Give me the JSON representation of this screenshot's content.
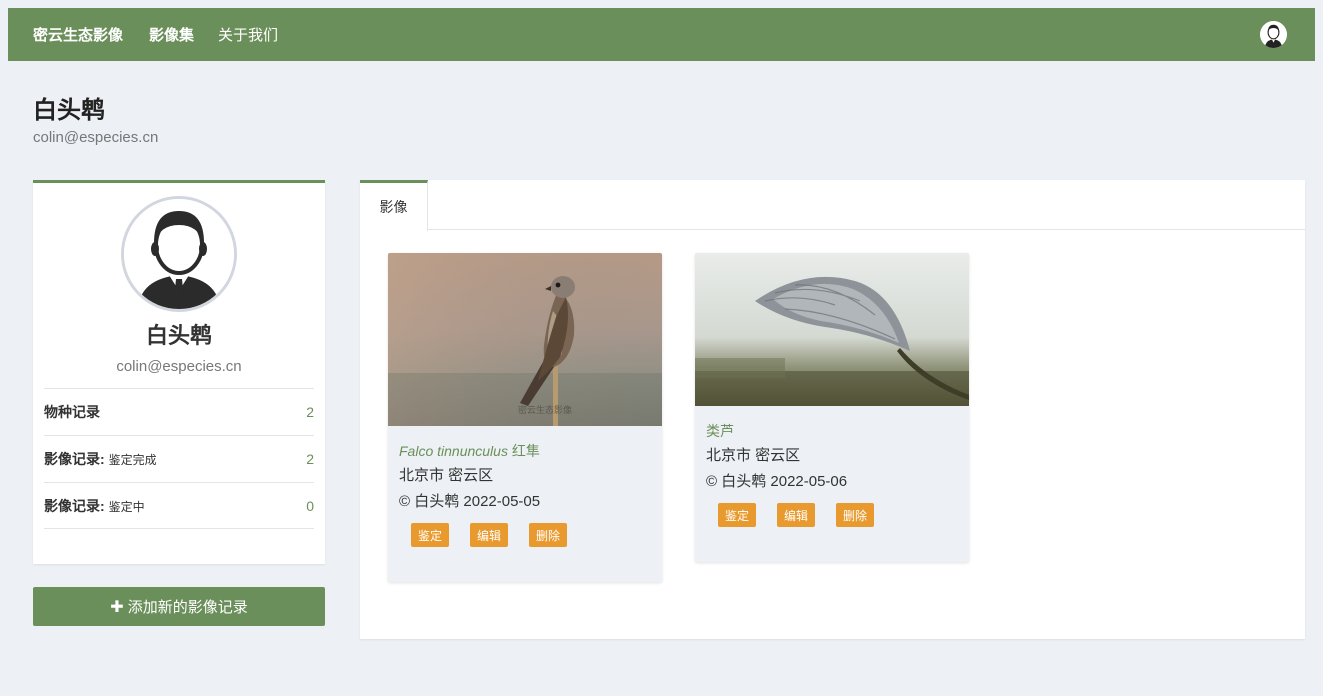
{
  "nav": {
    "brand": "密云生态影像",
    "collections": "影像集",
    "about": "关于我们"
  },
  "page": {
    "title": "白头鹎",
    "subtitle": "colin@especies.cn"
  },
  "profile": {
    "name": "白头鹎",
    "email": "colin@especies.cn",
    "stats": [
      {
        "label": "物种记录",
        "sub": "",
        "value": "2"
      },
      {
        "label": "影像记录:",
        "sub": "鉴定完成",
        "value": "2"
      },
      {
        "label": "影像记录:",
        "sub": "鉴定中",
        "value": "0"
      }
    ],
    "add_button": "添加新的影像记录"
  },
  "main": {
    "tab": "影像",
    "cards": [
      {
        "sci_name": "Falco tinnunculus",
        "common_name": "红隼",
        "location": "北京市 密云区",
        "credit": "© 白头鹎  2022-05-05",
        "watermark": "密云生态影像",
        "actions": [
          "鉴定",
          "编辑",
          "删除"
        ]
      },
      {
        "sci_name": "",
        "common_name": "类芦",
        "location": "北京市 密云区",
        "credit": "© 白头鹎  2022-05-06",
        "actions": [
          "鉴定",
          "编辑",
          "删除"
        ]
      }
    ]
  },
  "colors": {
    "primary": "#6b8f5a",
    "action": "#e99a2e",
    "background": "#edf1f5"
  },
  "icons": {
    "nav_avatar": "user-avatar-icon",
    "profile_avatar": "user-avatar-icon",
    "add": "plus-icon"
  }
}
